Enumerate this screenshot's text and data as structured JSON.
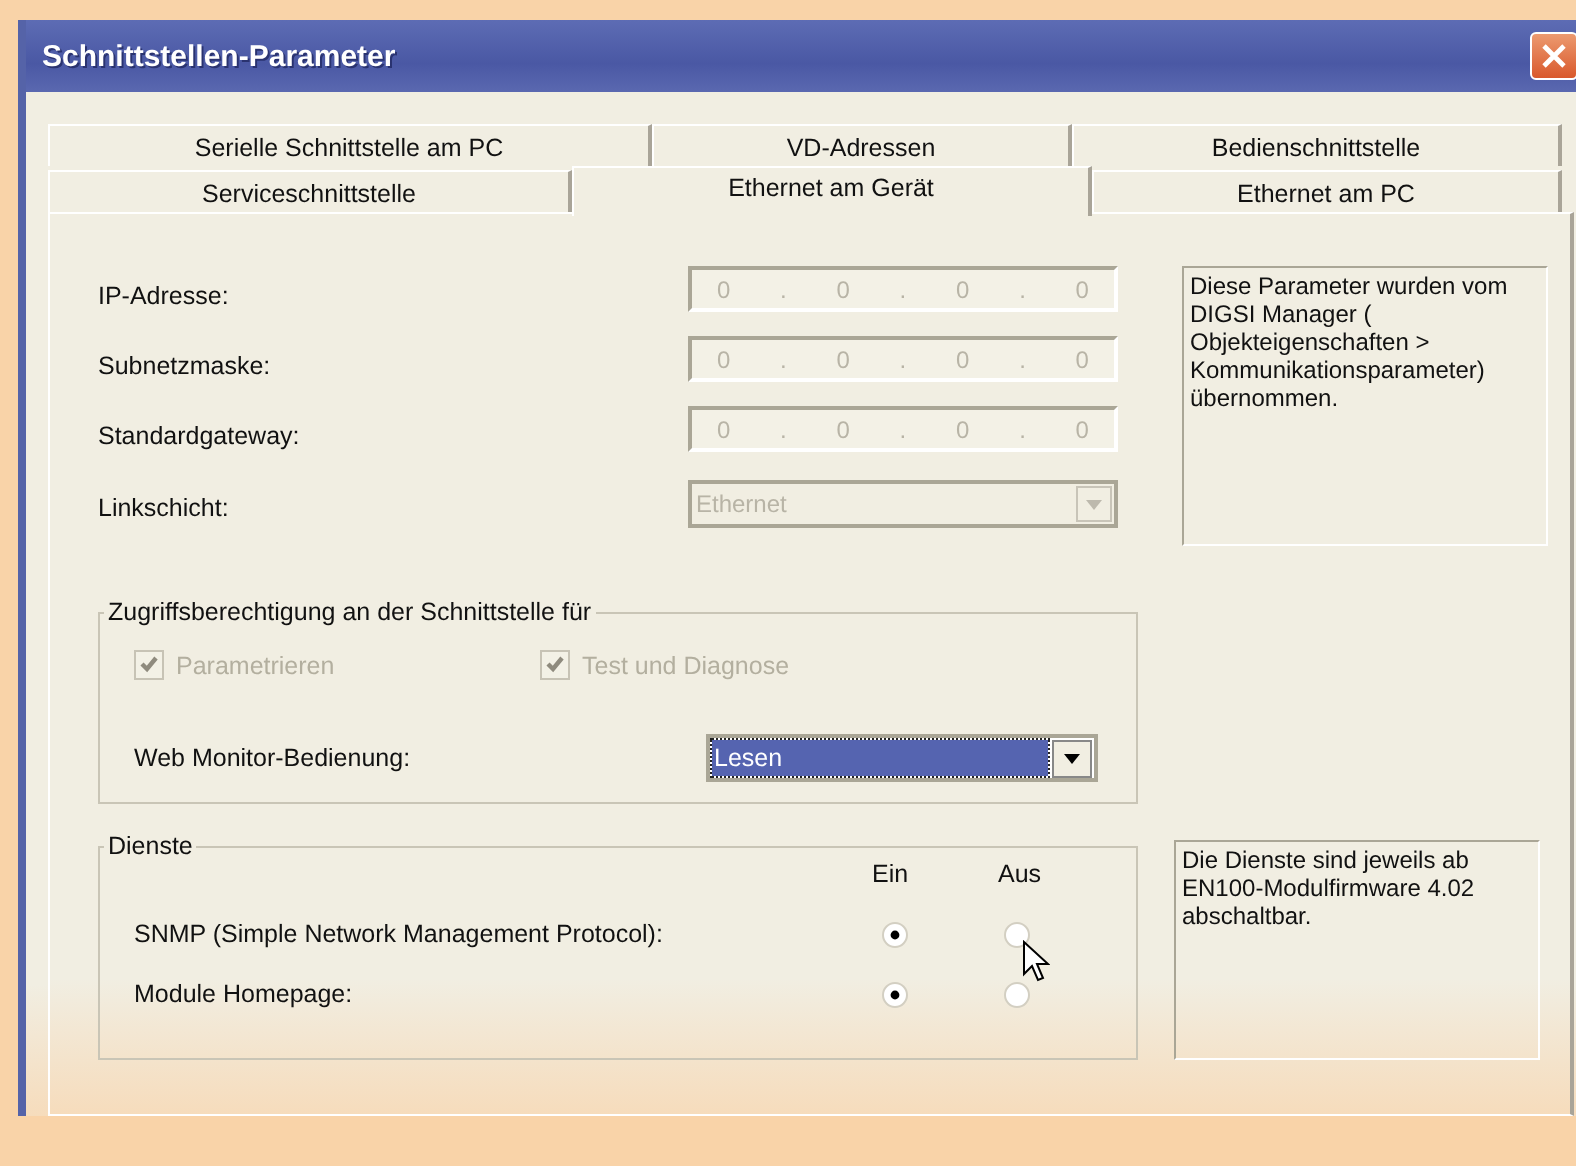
{
  "window": {
    "title": "Schnittstellen-Parameter"
  },
  "tab_rows": [
    [
      {
        "label": "Serielle Schnittstelle am PC",
        "selected": false
      },
      {
        "label": "VD-Adressen",
        "selected": false
      },
      {
        "label": "Bedienschnittstelle",
        "selected": false
      }
    ],
    [
      {
        "label": "Serviceschnittstelle",
        "selected": false
      },
      {
        "label": "Ethernet am Gerät",
        "selected": true
      },
      {
        "label": "Ethernet am PC",
        "selected": false
      }
    ]
  ],
  "fields": [
    {
      "label": "IP-Adresse:",
      "kind": "ip",
      "octets": [
        "0",
        "0",
        "0",
        "0"
      ],
      "separator": ".",
      "disabled": true
    },
    {
      "label": "Subnetzmaske:",
      "kind": "ip",
      "octets": [
        "0",
        "0",
        "0",
        "0"
      ],
      "separator": ".",
      "disabled": true
    },
    {
      "label": "Standardgateway:",
      "kind": "ip",
      "octets": [
        "0",
        "0",
        "0",
        "0"
      ],
      "separator": ".",
      "disabled": true
    },
    {
      "label": "Linkschicht:",
      "kind": "combo",
      "value": "Ethernet",
      "disabled": true
    }
  ],
  "info": "Diese Parameter wurden vom DIGSI Manager ( Objekteigenschaften > Kommunikationsparameter) übernommen.",
  "access": {
    "title": "Zugriffsberechtigung an der Schnittstelle für",
    "checkboxes": [
      {
        "label": "Parametrieren",
        "checked": true,
        "disabled": true
      },
      {
        "label": "Test und Diagnose",
        "checked": true,
        "disabled": true
      }
    ],
    "web_monitor": {
      "label": "Web Monitor-Bedienung:",
      "value": "Lesen",
      "focused": true
    }
  },
  "services": {
    "title": "Dienste",
    "columns": [
      "Ein",
      "Aus"
    ],
    "rows": [
      {
        "label": "SNMP (Simple Network Management Protocol):",
        "options": [
          {
            "selected": true
          },
          {
            "selected": false
          }
        ]
      },
      {
        "label": "Module Homepage:",
        "options": [
          {
            "selected": true
          },
          {
            "selected": false
          }
        ]
      }
    ]
  },
  "services_info": "Die Dienste sind jeweils ab EN100-Modulfirmware 4.02 abschaltbar."
}
